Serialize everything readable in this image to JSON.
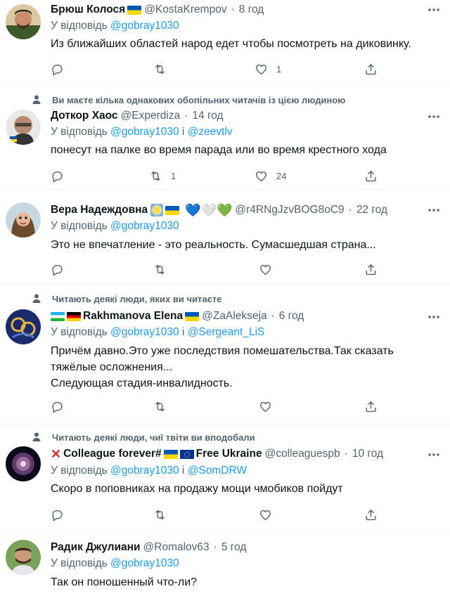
{
  "tweets": [
    {
      "name": "Брюш Колося",
      "handle": "@KostaKrempov",
      "time": "8 год",
      "reply_prefix": "У відповідь",
      "reply_to": [
        "@gobray1030"
      ],
      "text": [
        "Из ближайших областей народ едет чтобы посмотреть на диковинку."
      ],
      "counts": {
        "reply": "",
        "retweet": "",
        "like": "1"
      }
    },
    {
      "social": "Ви маєте кілька однакових обопільних читачів із цією людиною",
      "name": "Доткор Хаос",
      "handle": "@Experdiza",
      "time": "14 год",
      "reply_prefix": "У відповідь",
      "reply_to": [
        "@gobray1030",
        "@zeevtlv"
      ],
      "text": [
        "понесут на палке во время парада или во время крестного хода"
      ],
      "counts": {
        "reply": "",
        "retweet": "1",
        "like": "24"
      }
    },
    {
      "name": "Вера Надеждовна",
      "emoji_hearts": [
        "💙",
        "🤍",
        "💚"
      ],
      "handle": "@r4RNgJzvBOG8oC9",
      "time": "22 год",
      "reply_prefix": "У відповідь",
      "reply_to": [
        "@gobray1030"
      ],
      "text": [
        "Это не впечатление - это реальность. Сумасшедшая страна..."
      ],
      "counts": {
        "reply": "",
        "retweet": "",
        "like": ""
      }
    },
    {
      "social": "Читають деякі люди, яких ви читаєте",
      "name": "Rakhmanova Elena",
      "handle": "@ZaAlekseja",
      "time": "6 год",
      "reply_prefix": "У відповідь",
      "reply_to": [
        "@gobray1030",
        "@Sergeant_LiS"
      ],
      "text": [
        "Причём давно.Это уже последствия помешательства.Так сказать",
        "тяжёлые осложнения...",
        "Следующая стадия-инвалидность."
      ],
      "counts": {
        "reply": "",
        "retweet": "",
        "like": ""
      }
    },
    {
      "social": "Читають деякі люди, чиї твіти ви вподобали",
      "name_part1": "Colleague forever#",
      "name_part2": "Free Ukraine",
      "handle": "@colleaguespb",
      "time": "10 год",
      "reply_prefix": "У відповідь",
      "reply_to": [
        "@gobray1030",
        "@SomDRW"
      ],
      "text": [
        "Скоро в поповниках на продажу мощи чмобиков пойдут"
      ],
      "counts": {
        "reply": "",
        "retweet": "",
        "like": ""
      }
    },
    {
      "name": "Радик Джулиани",
      "handle": "@Romalov63",
      "time": "5 год",
      "reply_prefix": "У відповідь",
      "reply_to": [
        "@gobray1030"
      ],
      "text": [
        "Так он поношенный что-ли?"
      ]
    }
  ],
  "separator_dot": "·",
  "conjunction": "і",
  "colors": {
    "link": "#1d9bf0",
    "secondary": "#536471",
    "primary": "#0f1419",
    "divider": "#eff3f4"
  },
  "icons": [
    "reply-icon",
    "retweet-icon",
    "like-icon",
    "share-icon",
    "more-icon",
    "person-icon"
  ]
}
